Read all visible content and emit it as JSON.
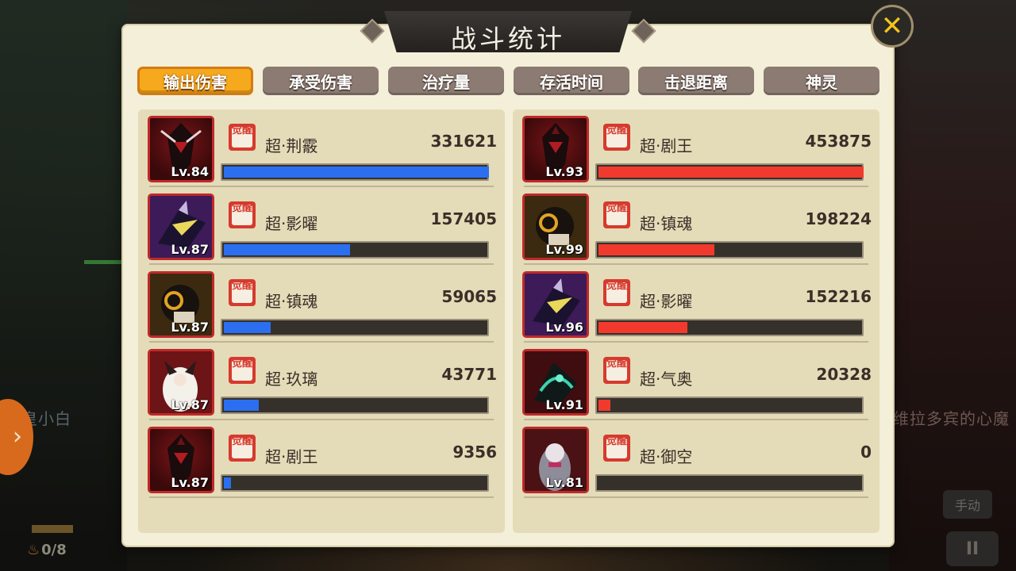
{
  "title": "战斗统计",
  "tabs": [
    {
      "label": "输出伤害",
      "active": true
    },
    {
      "label": "承受伤害",
      "active": false
    },
    {
      "label": "治疗量",
      "active": false
    },
    {
      "label": "存活时间",
      "active": false
    },
    {
      "label": "击退距离",
      "active": false
    },
    {
      "label": "神灵",
      "active": false
    }
  ],
  "badge_text": "觉醒",
  "left_team": {
    "bar_color": "#2b6ff0",
    "max_value": 331621,
    "units": [
      {
        "name": "超·荆霰",
        "level": "Lv.84",
        "value": "331621",
        "amount": 331621
      },
      {
        "name": "超·影曜",
        "level": "Lv.87",
        "value": "157405",
        "amount": 157405
      },
      {
        "name": "超·镇魂",
        "level": "Lv.87",
        "value": "59065",
        "amount": 59065
      },
      {
        "name": "超·玖璃",
        "level": "Lv.87",
        "value": "43771",
        "amount": 43771
      },
      {
        "name": "超·剧王",
        "level": "Lv.87",
        "value": "9356",
        "amount": 9356
      }
    ]
  },
  "right_team": {
    "bar_color": "#f13a2d",
    "max_value": 453875,
    "units": [
      {
        "name": "超·剧王",
        "level": "Lv.93",
        "value": "453875",
        "amount": 453875
      },
      {
        "name": "超·镇魂",
        "level": "Lv.99",
        "value": "198224",
        "amount": 198224
      },
      {
        "name": "超·影曜",
        "level": "Lv.96",
        "value": "152216",
        "amount": 152216
      },
      {
        "name": "超·气奥",
        "level": "Lv.91",
        "value": "20328",
        "amount": 20328
      },
      {
        "name": "超·御空",
        "level": "Lv.81",
        "value": "0",
        "amount": 0
      }
    ]
  },
  "background": {
    "left_player": "欧皇小白",
    "right_player": "维拉多宾的心魔",
    "energy": "0/8",
    "manual_label": "手动",
    "pause_label": "II",
    "arrow": "›"
  }
}
